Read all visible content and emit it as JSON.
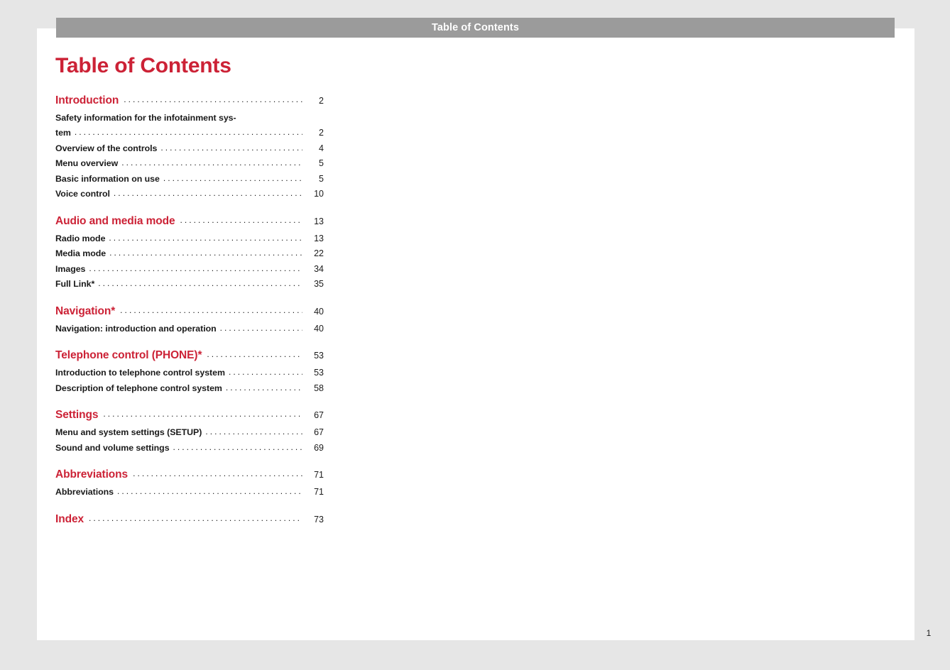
{
  "running_header": {
    "title": "Table of Contents"
  },
  "page": {
    "title": "Table of Contents",
    "folio": "1",
    "accent_color": "#cc2236",
    "header_bar_color": "#9b9b9b",
    "background_color": "#e6e6e6",
    "sheet_color": "#ffffff",
    "text_color": "#1a1a1a"
  },
  "toc": {
    "groups": [
      {
        "section": {
          "label": "Introduction",
          "page": "2"
        },
        "entries": [
          {
            "label": "Safety information for the infotainment sys-",
            "continuation": "tem",
            "page": "2",
            "wrapped": true
          },
          {
            "label": "Overview of the controls",
            "page": "4",
            "wrapped": false
          },
          {
            "label": "Menu overview",
            "page": "5",
            "wrapped": false
          },
          {
            "label": "Basic information on use",
            "page": "5",
            "wrapped": false
          },
          {
            "label": "Voice control",
            "page": "10",
            "wrapped": false
          }
        ]
      },
      {
        "section": {
          "label": "Audio and media mode",
          "page": "13"
        },
        "entries": [
          {
            "label": "Radio mode",
            "page": "13",
            "wrapped": false
          },
          {
            "label": "Media mode",
            "page": "22",
            "wrapped": false
          },
          {
            "label": "Images",
            "page": "34",
            "wrapped": false
          },
          {
            "label": "Full Link*",
            "page": "35",
            "wrapped": false
          }
        ]
      },
      {
        "section": {
          "label": "Navigation*",
          "page": "40"
        },
        "entries": [
          {
            "label": "Navigation: introduction and operation",
            "page": "40",
            "wrapped": false
          }
        ]
      },
      {
        "section": {
          "label": "Telephone control (PHONE)*",
          "page": "53"
        },
        "entries": [
          {
            "label": "Introduction to telephone control system",
            "page": "53",
            "wrapped": false
          },
          {
            "label": "Description of telephone control system",
            "page": "58",
            "wrapped": false
          }
        ]
      },
      {
        "section": {
          "label": "Settings",
          "page": "67"
        },
        "entries": [
          {
            "label": "Menu and system settings (SETUP)",
            "page": "67",
            "wrapped": false
          },
          {
            "label": "Sound and volume settings",
            "page": "69",
            "wrapped": false
          }
        ]
      },
      {
        "section": {
          "label": "Abbreviations",
          "page": "71"
        },
        "entries": [
          {
            "label": "Abbreviations",
            "page": "71",
            "wrapped": false
          }
        ]
      },
      {
        "section": {
          "label": "Index",
          "page": "73"
        },
        "entries": []
      }
    ]
  }
}
